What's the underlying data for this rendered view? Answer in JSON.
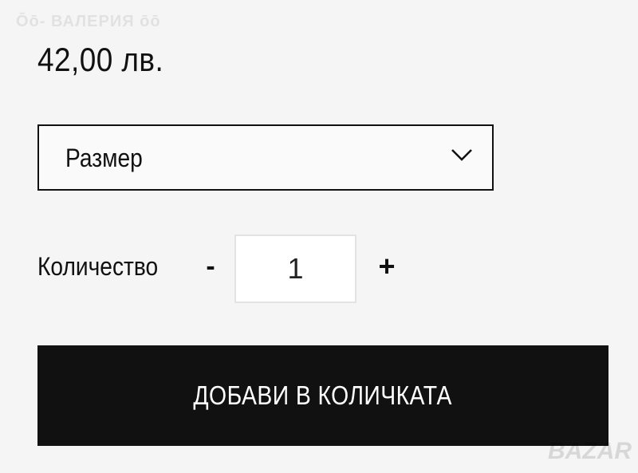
{
  "watermark_top": "Ōō- ВАЛЕРИЯ ōō",
  "product": {
    "price": "42,00 лв."
  },
  "size_select": {
    "label": "Размер",
    "icon": "chevron-down-icon"
  },
  "quantity": {
    "label": "Количество",
    "minus_label": "-",
    "value": "1",
    "plus_label": "+"
  },
  "add_to_cart": {
    "label": "ДОБАВИ В КОЛИЧКАТА"
  },
  "logo_watermark": "BAZAR",
  "colors": {
    "background": "#f5f5f5",
    "text": "#111111",
    "button_bg": "#111111",
    "button_text": "#ffffff",
    "input_border": "#e3e3e3"
  }
}
